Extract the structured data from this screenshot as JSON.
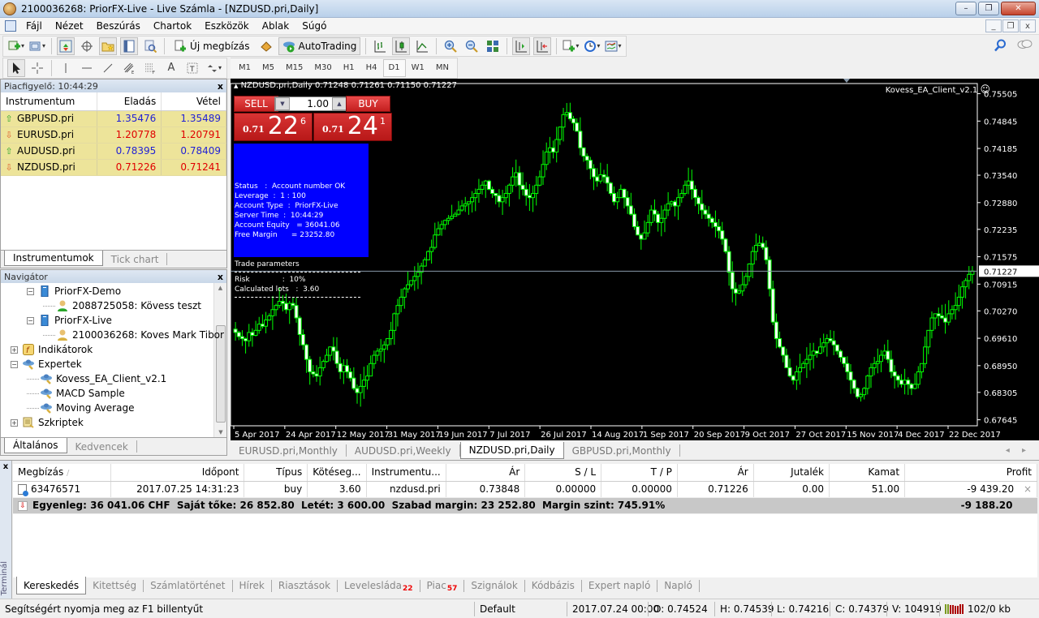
{
  "window": {
    "title": "2100036268: PriorFX-Live - Live Számla - [NZDUSD.pri,Daily]",
    "controls": {
      "minimize": "–",
      "restore": "❐",
      "close": "✕"
    }
  },
  "menu": {
    "items": [
      "Fájl",
      "Nézet",
      "Beszúrás",
      "Chartok",
      "Eszközök",
      "Ablak",
      "Súgó"
    ],
    "mdi_controls": {
      "minimize": "_",
      "restore": "❐",
      "close": "x"
    }
  },
  "toolbar": {
    "new_order_label": "Új megbízás",
    "autotrading_label": "AutoTrading",
    "timeframes": [
      "M1",
      "M5",
      "M15",
      "M30",
      "H1",
      "H4",
      "D1",
      "W1",
      "MN"
    ],
    "active_timeframe": "D1"
  },
  "market_watch": {
    "title": "Piacfigyelő: 10:44:29",
    "close": "x",
    "columns": [
      "Instrumentum",
      "Eladás",
      "Vétel"
    ],
    "rows": [
      {
        "symbol": "GBPUSD.pri",
        "bid": "1.35476",
        "ask": "1.35489",
        "dir": "up"
      },
      {
        "symbol": "EURUSD.pri",
        "bid": "1.20778",
        "ask": "1.20791",
        "dir": "down"
      },
      {
        "symbol": "AUDUSD.pri",
        "bid": "0.78395",
        "ask": "0.78409",
        "dir": "up"
      },
      {
        "symbol": "NZDUSD.pri",
        "bid": "0.71226",
        "ask": "0.71241",
        "dir": "down"
      }
    ],
    "tabs": [
      "Instrumentumok",
      "Tick chart"
    ],
    "active_tab": "Instrumentumok",
    "colors": {
      "up": "#1f1fd6",
      "down": "#e00000",
      "row_bg": "#ede49a"
    }
  },
  "navigator": {
    "title": "Navigátor",
    "close": "x",
    "items": [
      {
        "label": "PriorFX-Demo",
        "type": "server",
        "level": 1,
        "expander": "−"
      },
      {
        "label": "2088725058: Kövess teszt",
        "type": "account-demo",
        "level": 2
      },
      {
        "label": "PriorFX-Live",
        "type": "server",
        "level": 1,
        "expander": "−"
      },
      {
        "label": "2100036268: Koves Mark Tibor",
        "type": "account-live",
        "level": 2
      },
      {
        "label": "Indikátorok",
        "type": "indicators",
        "level": 0,
        "expander": "+"
      },
      {
        "label": "Expertek",
        "type": "experts",
        "level": 0,
        "expander": "−"
      },
      {
        "label": "Kovess_EA_Client_v2.1",
        "type": "expert",
        "level": 1
      },
      {
        "label": "MACD Sample",
        "type": "expert",
        "level": 1
      },
      {
        "label": "Moving Average",
        "type": "expert",
        "level": 1
      },
      {
        "label": "Szkriptek",
        "type": "scripts",
        "level": 0,
        "expander": "+"
      }
    ],
    "tabs": [
      "Általános",
      "Kedvencek"
    ],
    "active_tab": "Általános"
  },
  "chart": {
    "header": "NZDUSD.pri,Daily  0.71248 0.71261 0.71150 0.71227",
    "ea_name": "Kovess_EA_Client_v2.1",
    "ea_icon": "☺",
    "one_click": {
      "sell_label": "SELL",
      "buy_label": "BUY",
      "lot": "1.00",
      "sell_price_prefix": "0.71",
      "sell_price_big": "22",
      "sell_price_sup": "6",
      "buy_price_prefix": "0.71",
      "buy_price_big": "24",
      "buy_price_sup": "1"
    },
    "info": [
      "Status   :  Account number OK",
      "Leverage  :  1 : 100",
      "Account Type  :  PriorFX-Live",
      "Server Time  :  10:44:29",
      "Account Equity   = 36041.06",
      "Free Margin      = 23252.80"
    ],
    "trade_params_title": "Trade parameters",
    "trade_params": [
      "Risk              :  10%",
      "Calculated lots   :  3.60"
    ],
    "tabs": [
      "EURUSD.pri,Monthly",
      "AUDUSD.pri,Weekly",
      "NZDUSD.pri,Daily",
      "GBPUSD.pri,Monthly"
    ],
    "active_tab": "NZDUSD.pri,Daily",
    "tab_arrows": "◂ ▸",
    "colors": {
      "bg": "#000000",
      "candle": "#00ff00",
      "bid_line": "#8899aa",
      "info_bg": "#0000ff"
    }
  },
  "chart_data": {
    "type": "candlestick",
    "title": "NZDUSD.pri,Daily",
    "last_ohlc": {
      "open": 0.71248,
      "high": 0.71261,
      "low": 0.7115,
      "close": 0.71227
    },
    "current_price": 0.71227,
    "ylim": [
      0.675,
      0.7575
    ],
    "y_ticks": [
      "0.75505",
      "0.74845",
      "0.74185",
      "0.73540",
      "0.72880",
      "0.72235",
      "0.71575",
      "0.70915",
      "0.70270",
      "0.69610",
      "0.68950",
      "0.68305",
      "0.67645"
    ],
    "y_tick_values": [
      0.75505,
      0.74845,
      0.74185,
      0.7354,
      0.7288,
      0.72235,
      0.71575,
      0.70915,
      0.7027,
      0.6961,
      0.6895,
      0.68305,
      0.67645
    ],
    "x_ticks": [
      "5 Apr 2017",
      "24 Apr 2017",
      "12 May 2017",
      "31 May 2017",
      "19 Jun 2017",
      "7 Jul 2017",
      "26 Jul 2017",
      "14 Aug 2017",
      "1 Sep 2017",
      "20 Sep 2017",
      "9 Oct 2017",
      "27 Oct 2017",
      "15 Nov 2017",
      "4 Dec 2017",
      "22 Dec 2017"
    ],
    "close_path": [
      0.6975,
      0.6965,
      0.696,
      0.6955,
      0.6975,
      0.6968,
      0.698,
      0.6995,
      0.699,
      0.7005,
      0.7015,
      0.703,
      0.704,
      0.705,
      0.7045,
      0.703,
      0.7045,
      0.704,
      0.701,
      0.697,
      0.6945,
      0.691,
      0.688,
      0.6875,
      0.687,
      0.689,
      0.6905,
      0.692,
      0.694,
      0.693,
      0.69,
      0.688,
      0.6895,
      0.688,
      0.6865,
      0.684,
      0.683,
      0.6845,
      0.686,
      0.687,
      0.69,
      0.692,
      0.693,
      0.6935,
      0.6945,
      0.696,
      0.698,
      0.702,
      0.704,
      0.706,
      0.708,
      0.709,
      0.71,
      0.711,
      0.712,
      0.7135,
      0.715,
      0.717,
      0.718,
      0.721,
      0.7225,
      0.7235,
      0.7245,
      0.725,
      0.7255,
      0.726,
      0.727,
      0.728,
      0.7285,
      0.729,
      0.73,
      0.731,
      0.732,
      0.733,
      0.734,
      0.732,
      0.731,
      0.7305,
      0.729,
      0.73,
      0.731,
      0.733,
      0.735,
      0.736,
      0.733,
      0.732,
      0.7305,
      0.73,
      0.731,
      0.733,
      0.735,
      0.738,
      0.741,
      0.742,
      0.741,
      0.744,
      0.747,
      0.75,
      0.7505,
      0.749,
      0.748,
      0.746,
      0.742,
      0.74,
      0.739,
      0.737,
      0.735,
      0.734,
      0.7355,
      0.735,
      0.7335,
      0.731,
      0.729,
      0.73,
      0.732,
      0.73,
      0.728,
      0.726,
      0.723,
      0.721,
      0.72,
      0.7215,
      0.724,
      0.727,
      0.726,
      0.724,
      0.725,
      0.727,
      0.7285,
      0.729,
      0.728,
      0.73,
      0.731,
      0.733,
      0.734,
      0.732,
      0.73,
      0.7285,
      0.727,
      0.726,
      0.725,
      0.724,
      0.723,
      0.722,
      0.72,
      0.717,
      0.712,
      0.708,
      0.707,
      0.7075,
      0.709,
      0.711,
      0.714,
      0.717,
      0.7185,
      0.719,
      0.718,
      0.715,
      0.708,
      0.7,
      0.696,
      0.694,
      0.692,
      0.689,
      0.687,
      0.686,
      0.688,
      0.689,
      0.69,
      0.691,
      0.692,
      0.693,
      0.6925,
      0.694,
      0.695,
      0.696,
      0.6955,
      0.6945,
      0.693,
      0.6915,
      0.69,
      0.688,
      0.686,
      0.684,
      0.682,
      0.6825,
      0.684,
      0.687,
      0.689,
      0.69,
      0.6905,
      0.692,
      0.693,
      0.691,
      0.688,
      0.687,
      0.686,
      0.685,
      0.686,
      0.685,
      0.684,
      0.685,
      0.688,
      0.69,
      0.694,
      0.698,
      0.701,
      0.702,
      0.7015,
      0.701,
      0.7,
      0.702,
      0.703,
      0.704,
      0.706,
      0.7085,
      0.71,
      0.7115,
      0.7123
    ]
  },
  "terminal": {
    "side_label": "Terminál",
    "close": "x",
    "columns": [
      "Megbízás",
      "Időpont",
      "Típus",
      "Kötéseg...",
      "Instrumentu...",
      "Ár",
      "S / L",
      "T / P",
      "Ár",
      "Jutalék",
      "Kamat",
      "Profit"
    ],
    "sort_indicator": "/",
    "orders": [
      {
        "ticket": "63476571",
        "time": "2017.07.25 14:31:23",
        "type": "buy",
        "size": "3.60",
        "symbol": "nzdusd.pri",
        "open_price": "0.73848",
        "sl": "0.00000",
        "tp": "0.00000",
        "price": "0.71226",
        "commission": "0.00",
        "swap": "51.00",
        "profit": "-9 439.20",
        "close_icon": "×"
      }
    ],
    "summary": "Egyenleg: 36 041.06 CHF  Saját tőke: 26 852.80  Letét: 3 600.00  Szabad margin: 23 252.80  Margin szint: 745.91%",
    "summary_profit": "-9 188.20",
    "tabs": [
      {
        "label": "Kereskedés",
        "badge": ""
      },
      {
        "label": "Kitettség",
        "badge": ""
      },
      {
        "label": "Számlatörténet",
        "badge": ""
      },
      {
        "label": "Hírek",
        "badge": ""
      },
      {
        "label": "Riasztások",
        "badge": ""
      },
      {
        "label": "Levelesláda",
        "badge": "22"
      },
      {
        "label": "Piac",
        "badge": "57"
      },
      {
        "label": "Szignálok",
        "badge": ""
      },
      {
        "label": "Kódbázis",
        "badge": ""
      },
      {
        "label": "Expert napló",
        "badge": ""
      },
      {
        "label": "Napló",
        "badge": ""
      }
    ],
    "active_tab": "Kereskedés"
  },
  "statusbar": {
    "help": "Segítségért nyomja meg az F1 billentyűt",
    "profile": "Default",
    "datetime": "2017.07.24 00:00",
    "open": "O: 0.74524",
    "high": "H: 0.74539",
    "low": "L: 0.74216",
    "close": "C: 0.74379",
    "volume": "V: 104919",
    "traffic": "102/0 kb"
  }
}
